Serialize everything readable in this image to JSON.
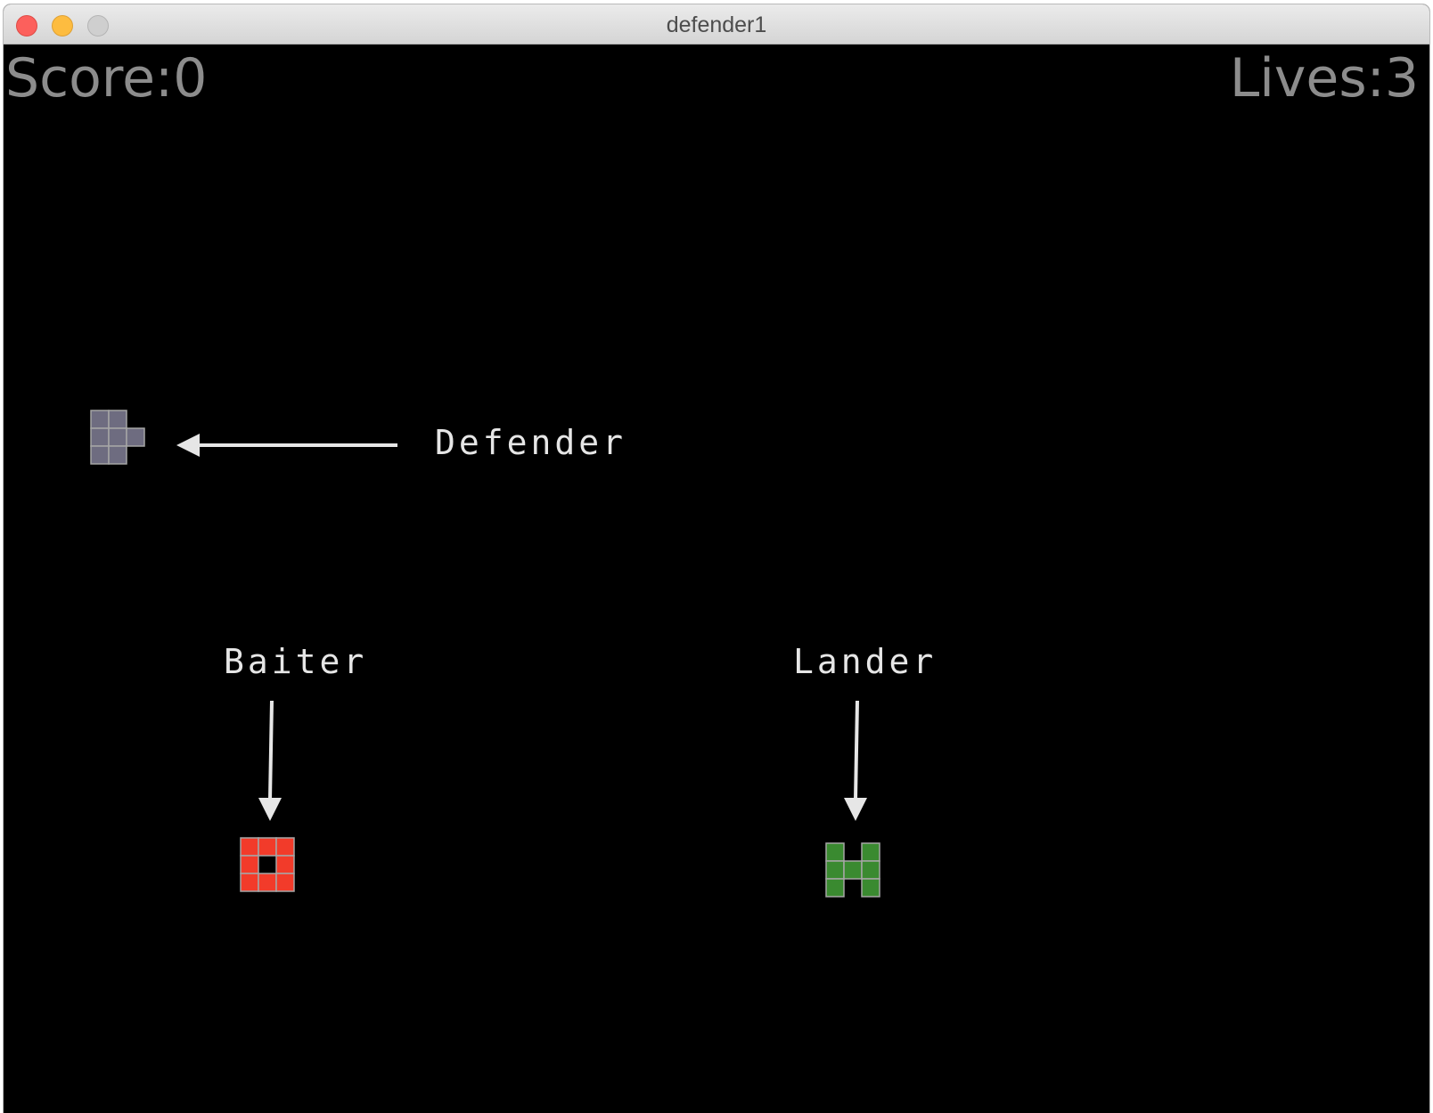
{
  "window": {
    "title": "defender1"
  },
  "hud": {
    "score_text": "Score:0",
    "lives_text": "Lives:3"
  },
  "labels": {
    "defender": "Defender",
    "baiter": "Baiter",
    "lander": "Lander"
  },
  "sprites": {
    "defender": {
      "name": "Defender",
      "color": "#6e6c80",
      "grid_color": "#a6a6a6"
    },
    "baiter": {
      "name": "Baiter",
      "color": "#f23b2a",
      "grid_color": "#a6a6a6"
    },
    "lander": {
      "name": "Lander",
      "color": "#3a8a30",
      "grid_color": "#a6a6a6"
    }
  },
  "colors": {
    "background": "#000000",
    "hud_text": "#8c8c8c",
    "label_text": "#e6e6e6",
    "arrow": "#e6e6e6"
  }
}
